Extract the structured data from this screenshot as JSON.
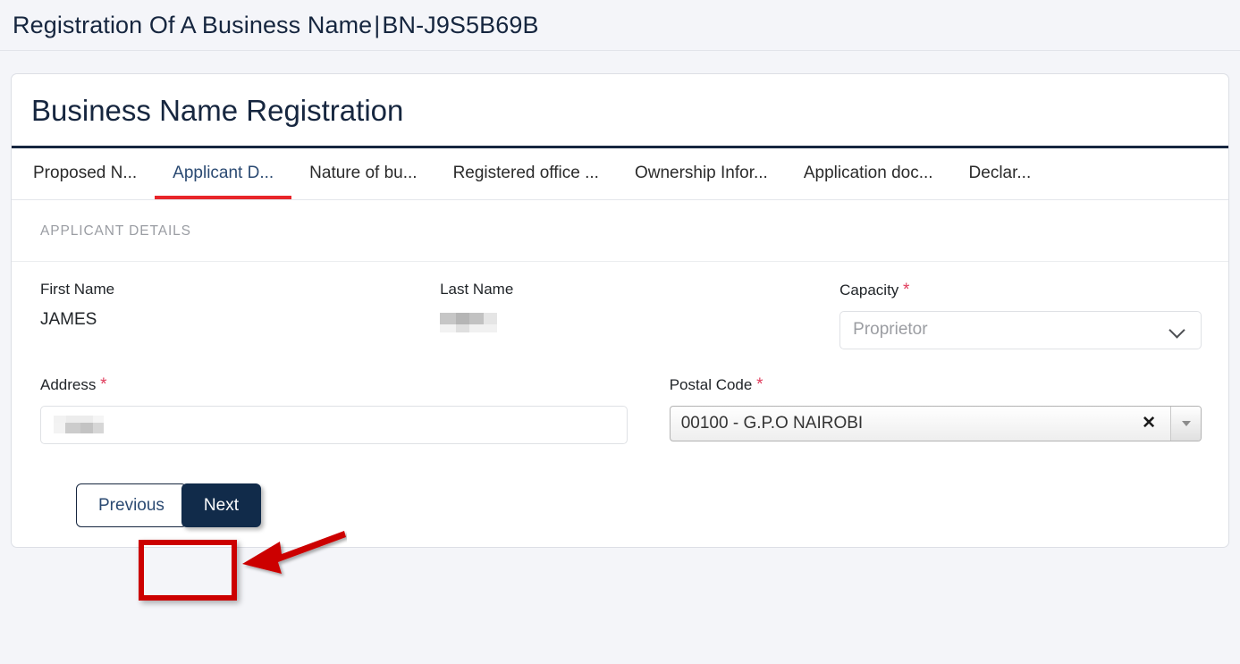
{
  "page_header": {
    "title_main": "Registration Of A Business Name",
    "separator": "|",
    "reference": "BN-J9S5B69B"
  },
  "card": {
    "title": "Business Name Registration",
    "tabs": [
      {
        "label": "Proposed N...",
        "active": false
      },
      {
        "label": "Applicant D...",
        "active": true
      },
      {
        "label": "Nature of bu...",
        "active": false
      },
      {
        "label": "Registered office ...",
        "active": false
      },
      {
        "label": "Ownership Infor...",
        "active": false
      },
      {
        "label": "Application doc...",
        "active": false
      },
      {
        "label": "Declar...",
        "active": false
      }
    ],
    "section_label": "APPLICANT DETAILS",
    "fields": {
      "first_name": {
        "label": "First Name",
        "value": "JAMES",
        "required": false
      },
      "last_name": {
        "label": "Last Name",
        "value": "",
        "required": false,
        "redacted": true
      },
      "capacity": {
        "label": "Capacity",
        "required_marker": "*",
        "value": "Proprietor",
        "icon": "chevron-down-icon"
      },
      "address": {
        "label": "Address",
        "required_marker": "*",
        "value": "",
        "redacted": true
      },
      "postal_code": {
        "label": "Postal Code",
        "required_marker": "*",
        "value": "00100 - G.P.O NAIROBI",
        "clear_icon": "close-icon",
        "dropdown_icon": "caret-down-icon"
      }
    },
    "buttons": {
      "previous": "Previous",
      "next": "Next"
    }
  },
  "annotations": {
    "highlight_target": "Next",
    "box_color": "#cc0000",
    "arrow_color": "#cc0000"
  },
  "colors": {
    "page_bg": "#f4f5f9",
    "navy": "#16263f",
    "button_navy": "#112b4a",
    "tab_active_underline": "#e8252a",
    "required_red": "#e03c5c"
  }
}
